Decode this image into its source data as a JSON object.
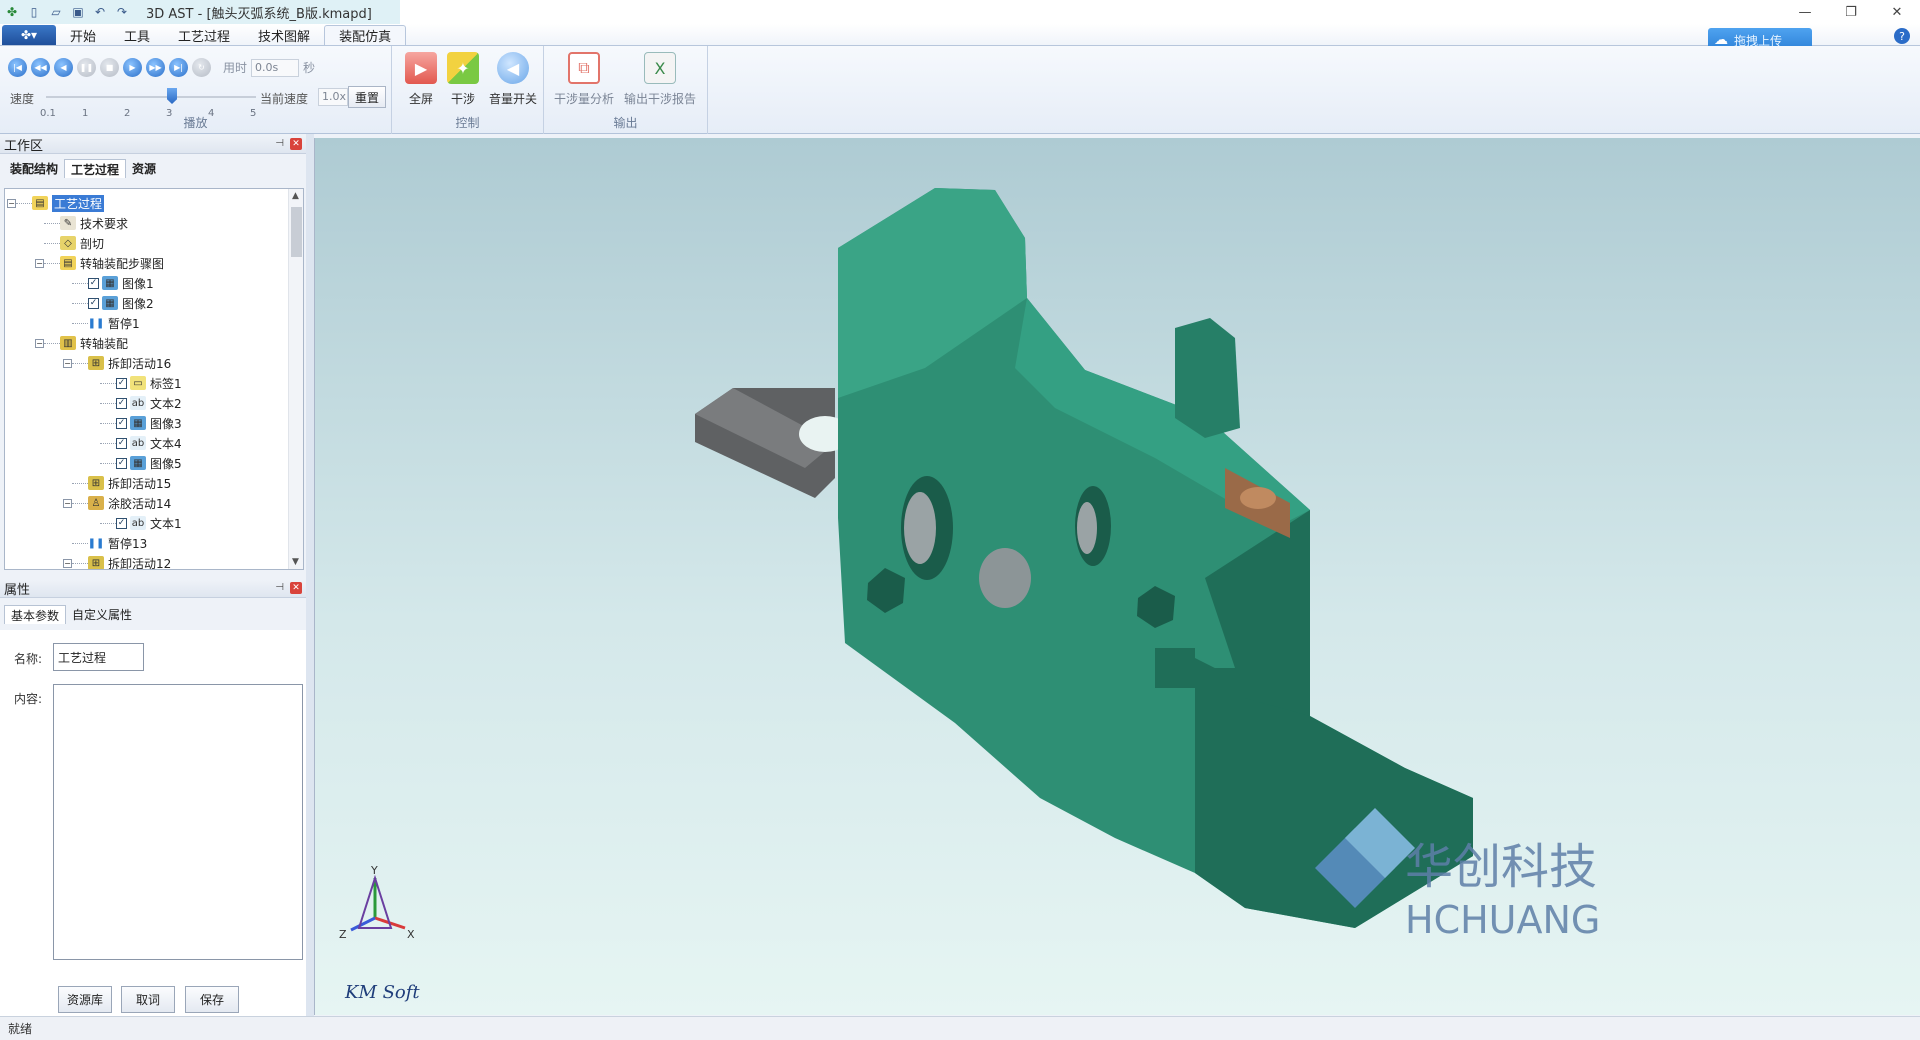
{
  "window": {
    "title": "3D AST - [触头灭弧系统_B版.kmapd]",
    "controls": {
      "minimize": "—",
      "restore": "❐",
      "close": "✕"
    }
  },
  "ribbon": {
    "tabs": [
      "开始",
      "工具",
      "工艺过程",
      "技术图解",
      "装配仿真"
    ],
    "active_tab": "装配仿真",
    "upload_label": "拖拽上传",
    "playback": {
      "group_label": "播放",
      "time_label": "用时",
      "time_value": "0.0s",
      "time_unit": "秒",
      "speed_label": "速度",
      "speed_ticks": [
        "0.1",
        "1",
        "2",
        "3",
        "4",
        "5"
      ],
      "speed_value": 3,
      "current_speed_label": "当前速度",
      "current_speed_value": "1.0x",
      "reset_label": "重置"
    },
    "control": {
      "group_label": "控制",
      "buttons": [
        "全屏",
        "干涉",
        "音量开关"
      ]
    },
    "output": {
      "group_label": "输出",
      "buttons": [
        "干涉量分析",
        "输出干涉报告"
      ]
    }
  },
  "workspace": {
    "title": "工作区",
    "tabs": [
      "装配结构",
      "工艺过程",
      "资源"
    ],
    "active_tab": "工艺过程",
    "tree": [
      {
        "label": "工艺过程",
        "level": 0,
        "expander": "⊟",
        "icon": "folder-icon",
        "selected": true
      },
      {
        "label": "技术要求",
        "level": 1,
        "icon": "doc-edit-icon"
      },
      {
        "label": "剖切",
        "level": 1,
        "icon": "cut-icon"
      },
      {
        "label": "转轴装配步骤图",
        "level": 1,
        "expander": "⊟",
        "icon": "folder-icon"
      },
      {
        "label": "图像1",
        "level": 2,
        "check": true,
        "icon": "image-icon"
      },
      {
        "label": "图像2",
        "level": 2,
        "check": true,
        "icon": "image-icon"
      },
      {
        "label": "暂停1",
        "level": 2,
        "icon": "pause-icon"
      },
      {
        "label": "转轴装配",
        "level": 1,
        "expander": "⊟",
        "icon": "assembly-icon"
      },
      {
        "label": "拆卸活动16",
        "level": 2,
        "expander": "⊟",
        "icon": "disassemble-icon"
      },
      {
        "label": "标签1",
        "level": 3,
        "check": true,
        "icon": "label-icon"
      },
      {
        "label": "文本2",
        "level": 3,
        "check": true,
        "icon": "text-icon"
      },
      {
        "label": "图像3",
        "level": 3,
        "check": true,
        "icon": "image-icon"
      },
      {
        "label": "文本4",
        "level": 3,
        "check": true,
        "icon": "text-icon"
      },
      {
        "label": "图像5",
        "level": 3,
        "check": true,
        "icon": "image-icon"
      },
      {
        "label": "拆卸活动15",
        "level": 2,
        "icon": "disassemble-icon"
      },
      {
        "label": "涂胶活动14",
        "level": 2,
        "expander": "⊟",
        "icon": "glue-icon"
      },
      {
        "label": "文本1",
        "level": 3,
        "check": true,
        "icon": "text-icon"
      },
      {
        "label": "暂停13",
        "level": 2,
        "icon": "pause-icon"
      },
      {
        "label": "拆卸活动12",
        "level": 2,
        "expander": "⊟",
        "icon": "disassemble-icon"
      }
    ]
  },
  "properties": {
    "title": "属性",
    "tabs": [
      "基本参数",
      "自定义属性"
    ],
    "active_tab": "基本参数",
    "name_label": "名称:",
    "name_value": "工艺过程",
    "content_label": "内容:",
    "content_value": "",
    "buttons": [
      "资源库",
      "取词",
      "保存"
    ]
  },
  "viewport": {
    "axes": {
      "y": "Y",
      "x": "X",
      "z": "Z"
    },
    "vendor_logo": "KM Soft",
    "watermark_cn": "华创科技",
    "watermark_en": "HCHUANG",
    "model_colors": {
      "body": "#2e8f74",
      "dark": "#1f6e58",
      "plate": "#6e7072",
      "copper": "#9a6a48"
    }
  },
  "status": {
    "text": "就绪"
  }
}
